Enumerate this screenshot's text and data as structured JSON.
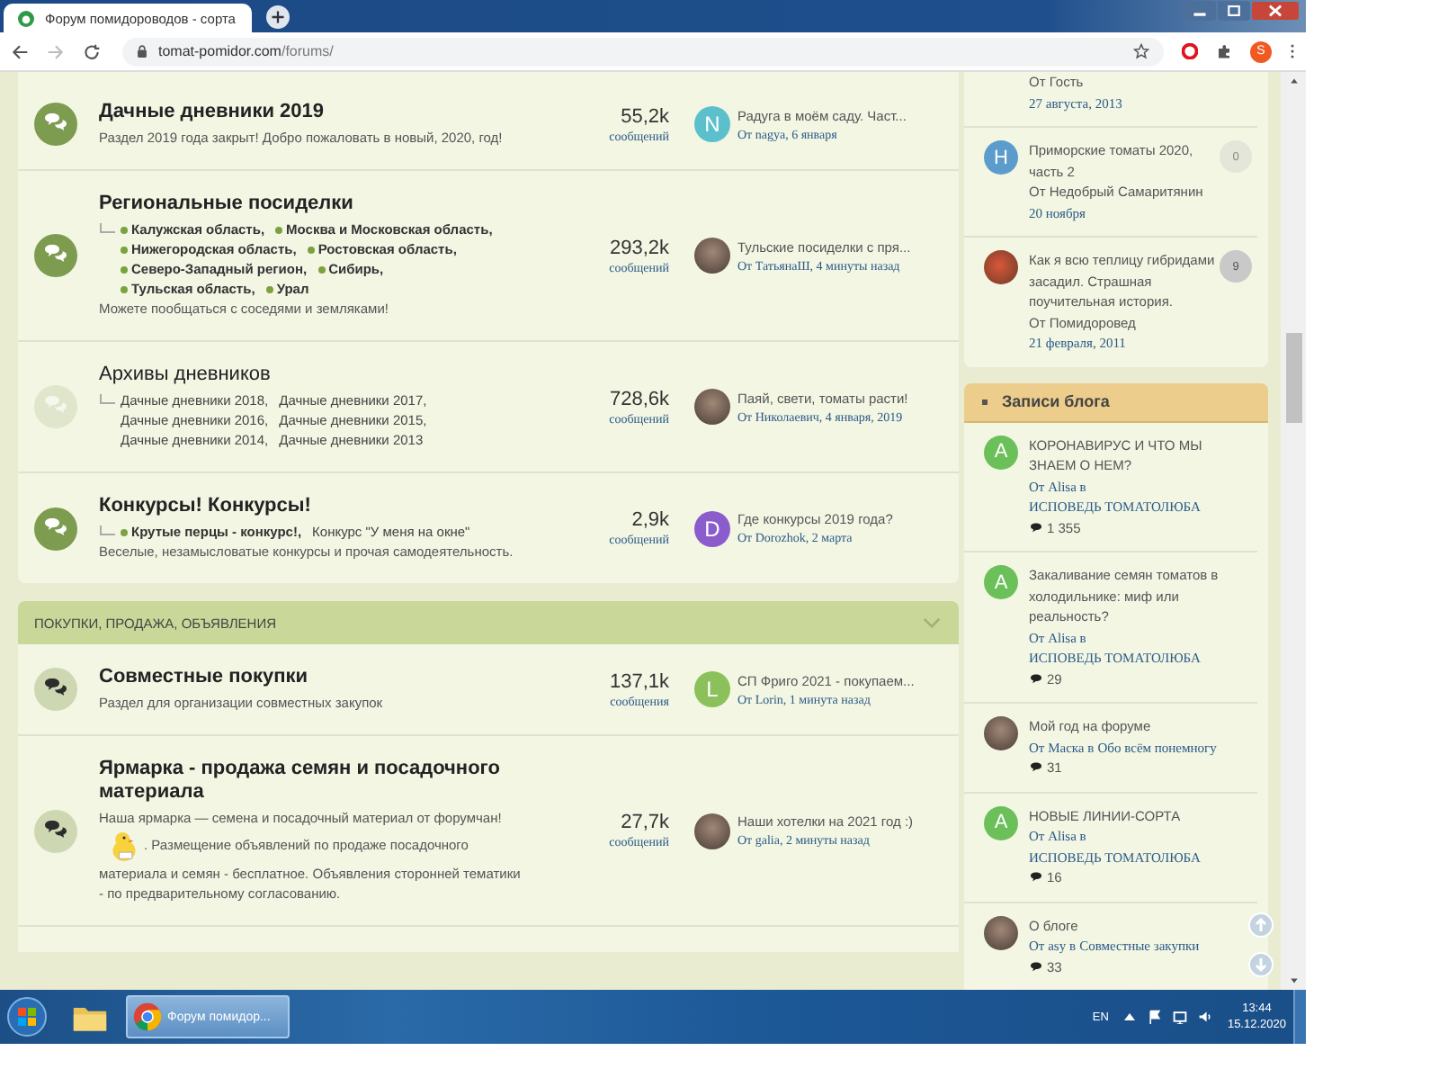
{
  "browser": {
    "tab_title": "Форум помидороводов - сорта",
    "url_host": "tomat-pomidor.com",
    "url_path": "/forums/",
    "profile_initial": "S"
  },
  "forum_groups": [
    {
      "forums": [
        {
          "title": "Дачные дневники 2019",
          "unread": true,
          "kind": "solid",
          "description": [
            {
              "kind": "text",
              "text": "Раздел 2019 года закрыт! Добро пожаловать в новый, 2020, год!"
            }
          ],
          "count": "55,2k",
          "count_label": "сообщений",
          "last": {
            "title": "Радуга в моём саду. Част...",
            "meta": "От nagya, 6 января",
            "avatar": {
              "kind": "letter",
              "letter": "N",
              "color": "#5cc0cc"
            }
          }
        },
        {
          "title": "Региональные посиделки",
          "unread": true,
          "kind": "solid",
          "subforums": [
            {
              "name": "Калужская область,",
              "unread": true
            },
            {
              "name": "Москва и Московская область,",
              "unread": true
            },
            {
              "name": "Нижегородская область,",
              "unread": true
            },
            {
              "name": "Ростовская область,",
              "unread": true
            },
            {
              "name": "Северо-Западный регион,",
              "unread": true
            },
            {
              "name": "Сибирь,",
              "unread": true
            },
            {
              "name": "Тульская область,",
              "unread": true
            },
            {
              "name": "Урал",
              "unread": true
            }
          ],
          "description": [
            {
              "kind": "text",
              "text": "Можете пообщаться с соседями и земляками!"
            }
          ],
          "count": "293,2k",
          "count_label": "сообщений",
          "last": {
            "title": "Тульские посиделки с пря...",
            "meta": "От ТатьянаШ, 4 минуты назад",
            "avatar": {
              "kind": "photo"
            }
          }
        },
        {
          "title": "Архивы дневников",
          "unread": false,
          "kind": "faded",
          "subforums": [
            {
              "name": "Дачные дневники 2018,",
              "unread": false
            },
            {
              "name": "Дачные дневники 2017,",
              "unread": false
            },
            {
              "name": "Дачные дневники 2016,",
              "unread": false
            },
            {
              "name": "Дачные дневники 2015,",
              "unread": false
            },
            {
              "name": "Дачные дневники 2014,",
              "unread": false
            },
            {
              "name": "Дачные дневники 2013",
              "unread": false
            }
          ],
          "count": "728,6k",
          "count_label": "сообщений",
          "last": {
            "title": "Паяй, свети, томаты расти!",
            "meta": "От Николаевич, 4 января, 2019",
            "avatar": {
              "kind": "photo"
            }
          }
        },
        {
          "title": "Конкурсы! Конкурсы!",
          "unread": true,
          "kind": "solid",
          "subforums": [
            {
              "name": "Крутые перцы - конкурс!,",
              "unread": true
            },
            {
              "name": "Конкурс \"У меня на окне\"",
              "unread": false
            }
          ],
          "description": [
            {
              "kind": "text",
              "text": "Веселые, незамысловатые конкурсы и прочая самодеятельность."
            }
          ],
          "count": "2,9k",
          "count_label": "сообщений",
          "last": {
            "title": "Где конкурсы 2019 года?",
            "meta": "От Dorozhok, 2 марта",
            "avatar": {
              "kind": "letter",
              "letter": "D",
              "color": "#8a5ccc"
            }
          }
        }
      ]
    },
    {
      "header": "ПОКУПКИ, ПРОДАЖА, ОБЪЯВЛЕНИЯ",
      "forums": [
        {
          "title": "Совместные покупки",
          "unread": true,
          "kind": "light",
          "description": [
            {
              "kind": "text",
              "text": "Раздел для организации совместных закупок"
            }
          ],
          "count": "137,1k",
          "count_label": "сообщения",
          "last": {
            "title": "СП Фриго 2021 - покупаем...",
            "meta": "От Lorin, 1 минута назад",
            "avatar": {
              "kind": "letter",
              "letter": "L",
              "color": "#8cc05a"
            }
          }
        },
        {
          "title": "Ярмарка - продажа семян и посадочного материала",
          "unread": true,
          "kind": "light",
          "description": [
            {
              "kind": "text",
              "text": "Наша ярмарка — семена и посадочный материал от форумчан!"
            },
            {
              "kind": "smiley"
            },
            {
              "kind": "text",
              "text": ". Размещение объявлений по продаже посадочного материала и семян - бесплатное. Объявления сторонней тематики - по предварительному согласованию."
            }
          ],
          "count": "27,7k",
          "count_label": "сообщений",
          "last": {
            "title": "Наши хотелки на 2021 год :)",
            "meta": "От galia, 2 минуты назад",
            "avatar": {
              "kind": "photo"
            }
          }
        }
      ]
    }
  ],
  "sidebar": {
    "threads": [
      {
        "author": "От Гость",
        "date": "27 августа, 2013"
      },
      {
        "title": "Приморские томаты 2020, часть 2",
        "author": "От Недобрый Самаритянин",
        "date": "20 ноября",
        "avatar": {
          "kind": "letter",
          "letter": "H",
          "color": "#5c9ccc"
        },
        "replies": "0",
        "highlight": false
      },
      {
        "title": "Как я всю теплицу гибридами засадил. Страшная поучительная история.",
        "author": "От Помидоровед",
        "date": "21 февраля, 2011",
        "avatar": {
          "kind": "photo"
        },
        "replies": "9",
        "highlight": true
      }
    ],
    "blog": {
      "title": "Записи блога",
      "entries": [
        {
          "title": "КОРОНАВИРУС И ЧТО МЫ ЗНАЕМ О НЕМ?",
          "author": "От Alisa в",
          "blog": "ИСПОВЕДЬ ТОМАТОЛЮБА",
          "comments": "1 355",
          "avatar": {
            "kind": "letter",
            "letter": "A",
            "color": "#6cc05a"
          }
        },
        {
          "title": "Закаливание семян томатов в холодильнике: миф или реальность?",
          "author": "От Alisa в",
          "blog": "ИСПОВЕДЬ ТОМАТОЛЮБА",
          "comments": "29",
          "avatar": {
            "kind": "letter",
            "letter": "A",
            "color": "#6cc05a"
          }
        },
        {
          "title": "Мой год на форуме",
          "author": "От Маска в",
          "blog": "Обо всём понемногу",
          "comments": "31",
          "avatar": {
            "kind": "photo"
          }
        },
        {
          "title": "НОВЫЕ ЛИНИИ-СОРТА",
          "author": "От Alisa в",
          "blog": "ИСПОВЕДЬ ТОМАТОЛЮБА",
          "comments": "16",
          "avatar": {
            "kind": "letter",
            "letter": "A",
            "color": "#6cc05a"
          }
        },
        {
          "title": "О блоге",
          "author": "От asy в",
          "blog": "Совместные закупки",
          "comments": "33",
          "avatar": {
            "kind": "photo"
          }
        }
      ]
    }
  },
  "taskbar": {
    "window_title": "Форум помидор...",
    "language": "EN",
    "time": "13:44",
    "date": "15.12.2020"
  }
}
